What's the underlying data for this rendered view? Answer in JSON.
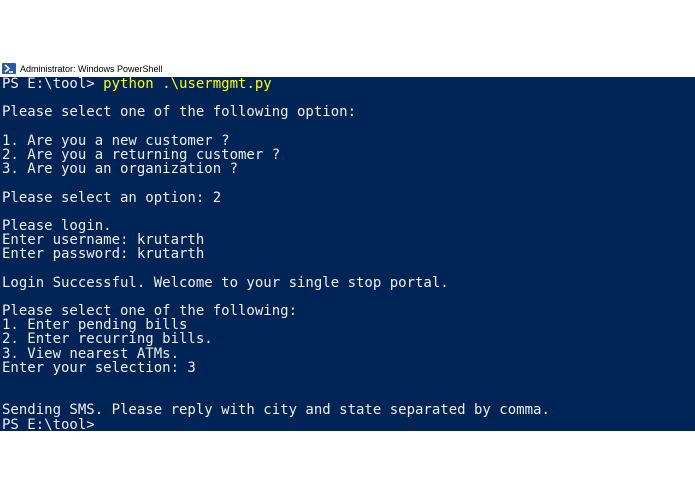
{
  "window": {
    "title": "Administrator: Windows PowerShell",
    "icon": "powershell-icon",
    "colors": {
      "background": "#012456",
      "foreground": "#eeedf0",
      "command": "#ffff00"
    }
  },
  "console": {
    "prompt1": "PS E:\\tool> ",
    "command": "python .\\usermgmt.py",
    "lines": [
      "",
      "Please select one of the following option:",
      "",
      "1. Are you a new customer ?",
      "2. Are you a returning customer ?",
      "3. Are you an organization ?",
      "",
      "Please select an option: 2",
      "",
      "Please login.",
      "Enter username: krutarth",
      "Enter password: krutarth",
      "",
      "Login Successful. Welcome to your single stop portal.",
      "",
      "Please select one of the following:",
      "1. Enter pending bills",
      "2. Enter recurring bills.",
      "3. View nearest ATMs.",
      "Enter your selection: 3",
      "",
      "",
      "Sending SMS. Please reply with city and state separated by comma.",
      "PS E:\\tool>"
    ]
  }
}
